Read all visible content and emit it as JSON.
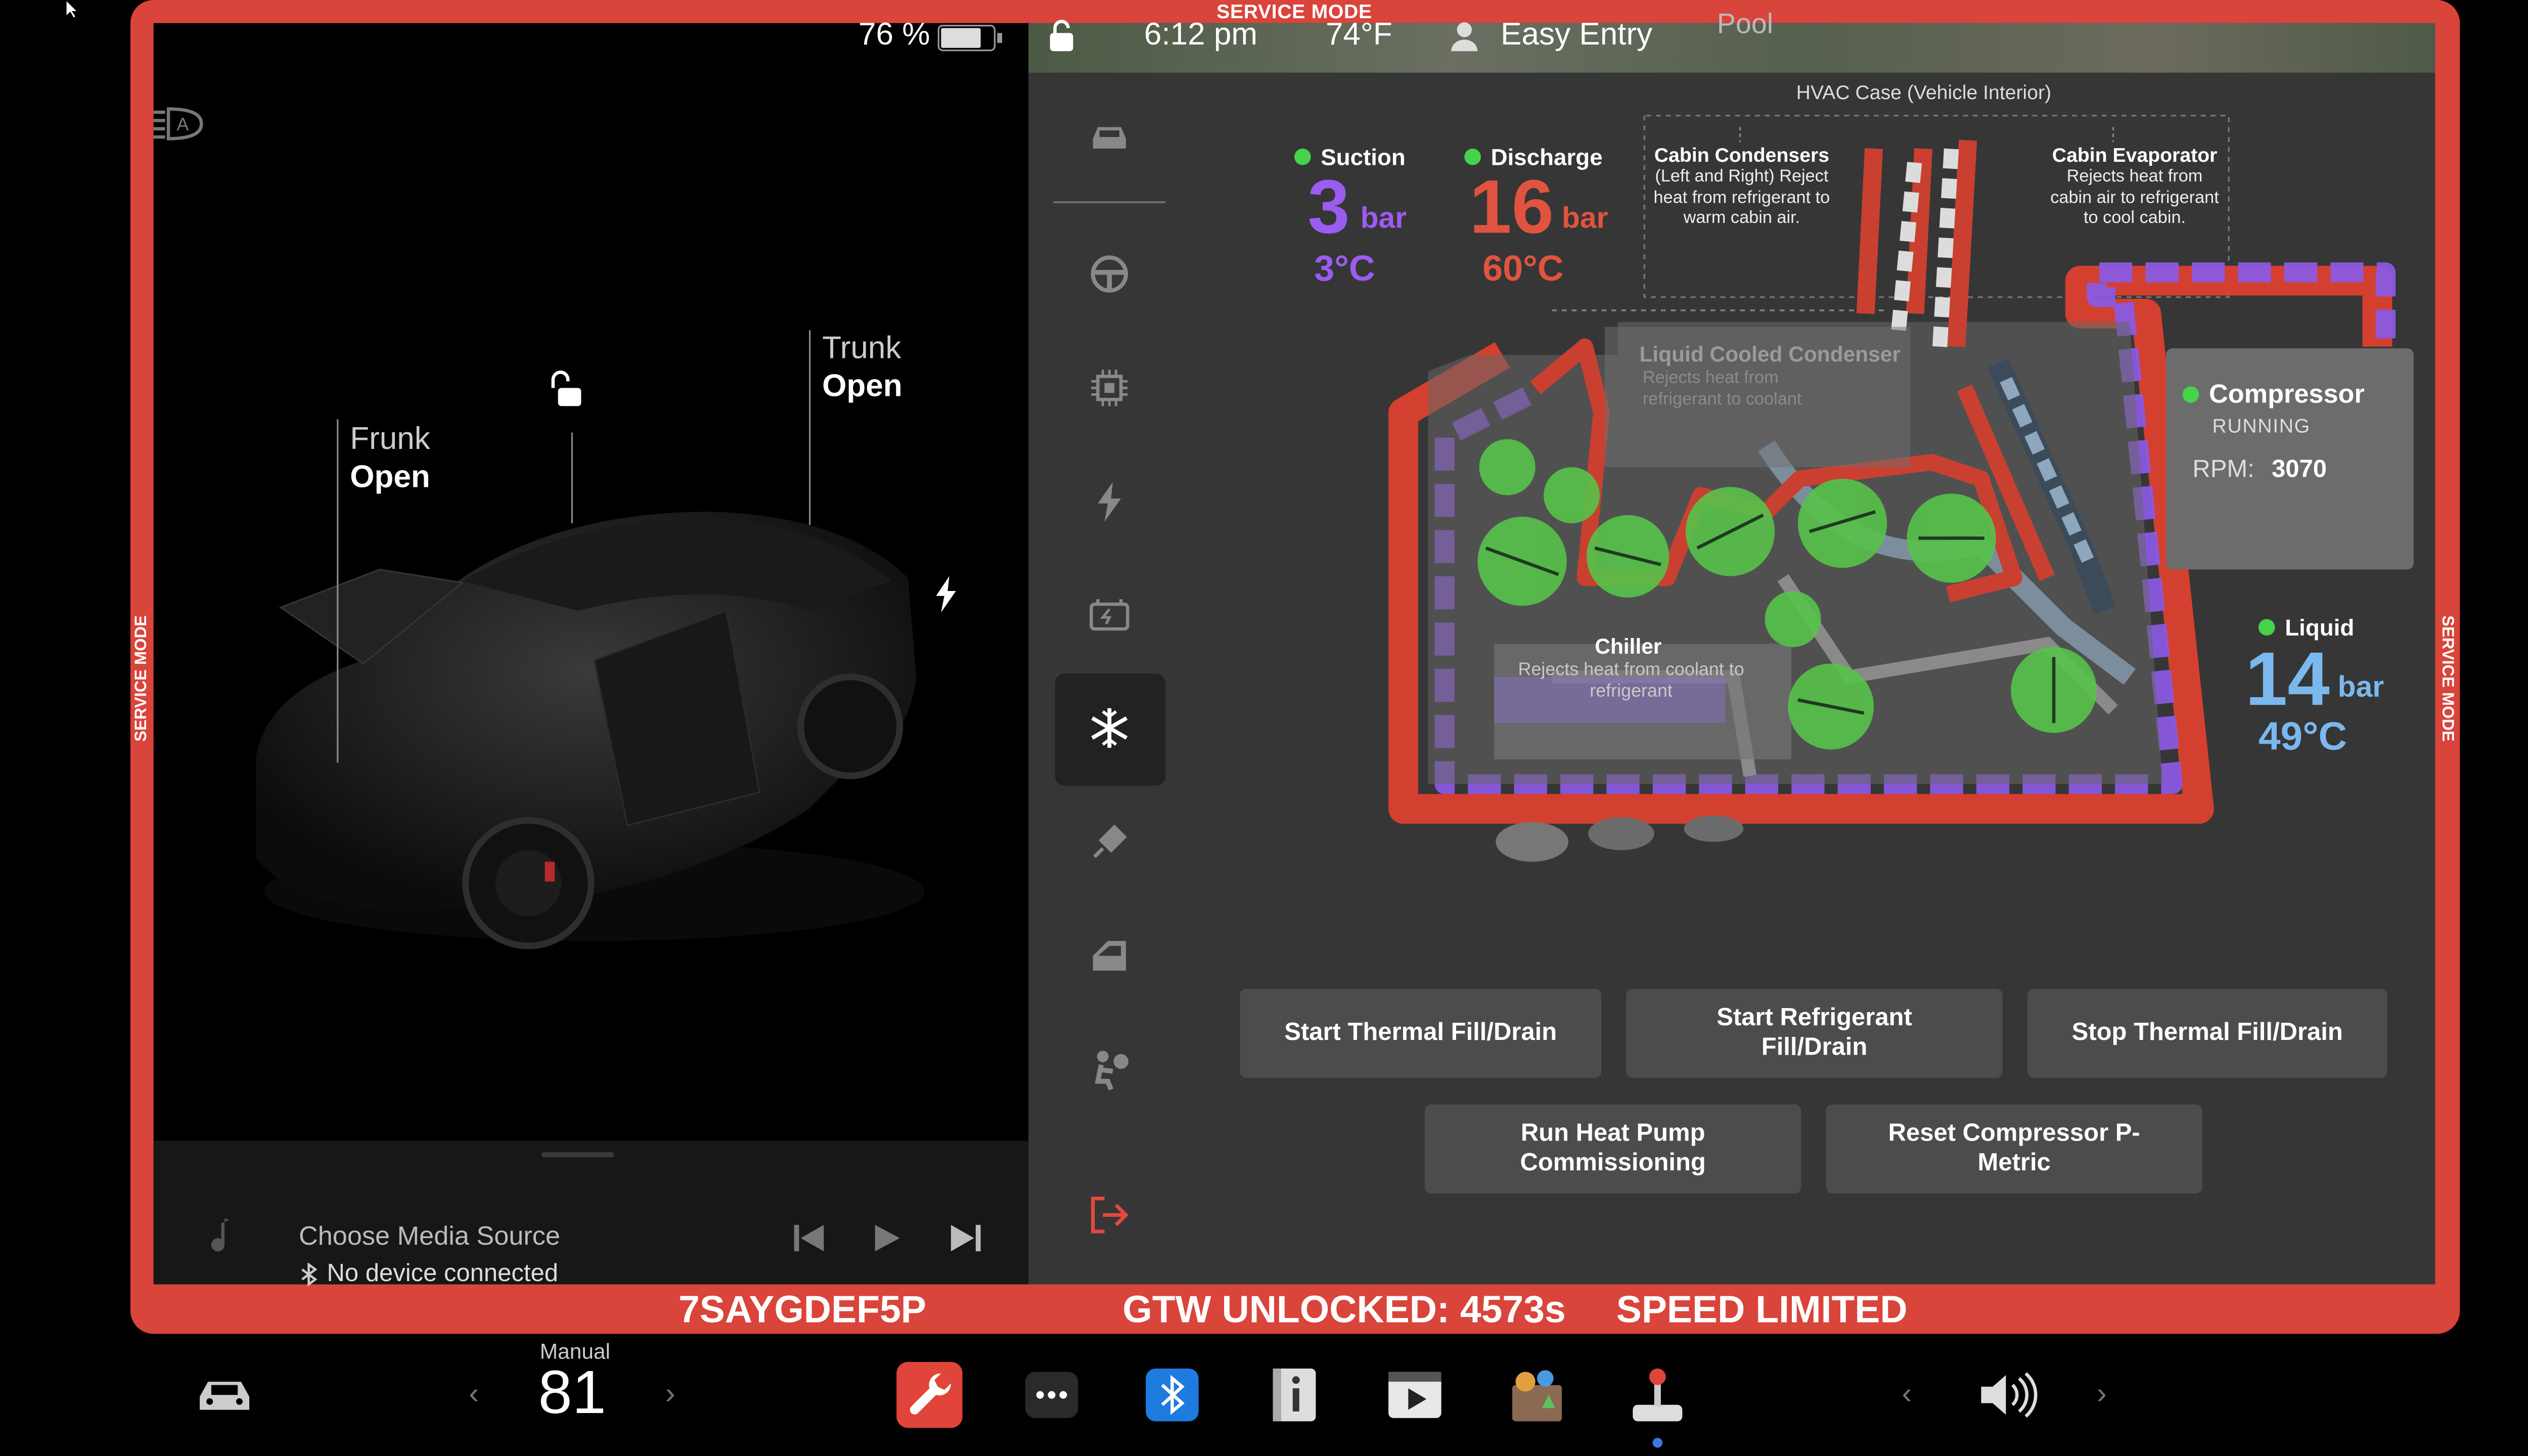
{
  "service_mode_label": "SERVICE MODE",
  "status_bar": {
    "battery_percent": "76 %",
    "battery_level": 0.76,
    "time": "6:12 pm",
    "temperature": "74°F",
    "profile": "Easy Entry",
    "map_text": "Pool"
  },
  "car": {
    "frunk_label": "Frunk",
    "frunk_state": "Open",
    "trunk_label": "Trunk",
    "trunk_state": "Open"
  },
  "media": {
    "title": "Choose Media Source",
    "subtitle": "No device connected"
  },
  "nav": {
    "items": [
      "car-icon",
      "steering-wheel-icon",
      "chip-icon",
      "bolt-icon",
      "battery-icon",
      "snowflake-icon",
      "syringe-icon",
      "door-icon",
      "airbag-icon",
      "exit-icon"
    ],
    "active": "snowflake-icon"
  },
  "diagram": {
    "hvac_case": "HVAC Case (Vehicle Interior)",
    "cabin_condensers_title": "Cabin Condensers",
    "cabin_condensers_note": "(Left and Right) Reject heat from refrigerant to warm cabin air.",
    "cabin_evaporator_title": "Cabin Evaporator",
    "cabin_evaporator_note": "Rejects heat from cabin air to refrigerant to cool cabin.",
    "suction": {
      "label": "Suction",
      "value": "3",
      "unit": "bar",
      "temp": "3°C"
    },
    "discharge": {
      "label": "Discharge",
      "value": "16",
      "unit": "bar",
      "temp": "60°C"
    },
    "liquid": {
      "label": "Liquid",
      "value": "14",
      "unit": "bar",
      "temp": "49°C"
    },
    "lcc_title": "Liquid Cooled Condenser",
    "lcc_note": "Rejects heat from refrigerant to coolant",
    "chiller_title": "Chiller",
    "chiller_note": "Rejects heat from coolant to refrigerant",
    "compressor": {
      "title": "Compressor",
      "state": "RUNNING",
      "rpm_label": "RPM:",
      "rpm": "3070"
    },
    "colors": {
      "suction": "#9b5cf0",
      "discharge": "#e0543f",
      "liquid": "#7ab8ee",
      "ok": "#44d34a"
    }
  },
  "buttons": {
    "start_thermal": "Start Thermal Fill/Drain",
    "start_refrigerant": "Start Refrigerant Fill/Drain",
    "stop_thermal": "Stop Thermal Fill/Drain",
    "run_heat_pump": "Run Heat Pump Commissioning",
    "reset_compressor": "Reset Compressor P-Metric"
  },
  "footer": {
    "vin": "7SAYGDEF5P",
    "gtw": "GTW UNLOCKED: 4573s",
    "speed": "SPEED LIMITED"
  },
  "dock": {
    "climate_mode": "Manual",
    "climate_temp": "81",
    "icons": [
      "car-icon",
      "wrench-icon",
      "more-icon",
      "bluetooth-icon",
      "info-icon",
      "video-icon",
      "toybox-icon",
      "joystick-icon",
      "volume-icon"
    ]
  }
}
